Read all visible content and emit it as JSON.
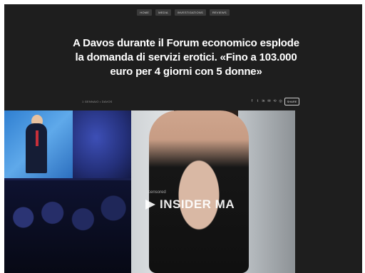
{
  "nav": {
    "categories": [
      "Home",
      "Media",
      "Investigations",
      "Reviews"
    ]
  },
  "article": {
    "headline": "A Davos durante il Forum economico esplode la domanda di servizi erotici. «Fino a 103.000 euro per 4 giorni con 5 donne»",
    "date": "1 GENNAIO • DAVOS",
    "share_button": "SHARE",
    "share_icons": [
      "f",
      "t",
      "in",
      "✉",
      "⟲",
      "◎"
    ]
  },
  "images": {
    "left_alt": "Davos forum speaker on screen with audience",
    "right_watermark": "INSIDER MA",
    "right_watermark_small": "censored"
  }
}
